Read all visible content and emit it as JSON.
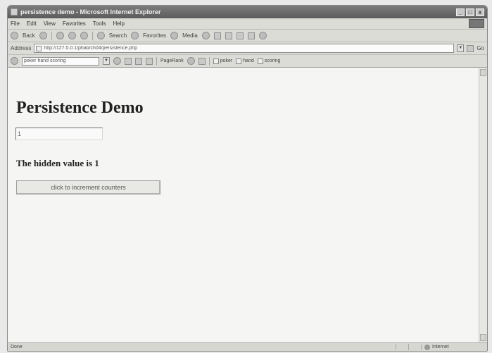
{
  "window": {
    "title": "persistence demo - Microsoft Internet Explorer",
    "controls": [
      "_",
      "□",
      "x"
    ]
  },
  "menubar": {
    "items": [
      "File",
      "Edit",
      "View",
      "Favorites",
      "Tools",
      "Help"
    ]
  },
  "toolbar": {
    "back_label": "Back",
    "search_label": "Search",
    "favorites_label": "Favorites",
    "media_label": "Media"
  },
  "addressbar": {
    "label": "Address",
    "url": "http://127.0.0.1/phab/ch04/persistence.php",
    "go_label": "Go"
  },
  "googlebar": {
    "search_value": "poker hand scoring",
    "pagerank_label": "PageRank",
    "buttons": [
      "poker",
      "hand",
      "scoring"
    ]
  },
  "page": {
    "heading": "Persistence Demo",
    "text_input_value": "1",
    "hidden_value_text": "The hidden value is 1",
    "button_label": "click to increment counters"
  },
  "statusbar": {
    "left_text": "Done",
    "zone_text": "Internet"
  }
}
